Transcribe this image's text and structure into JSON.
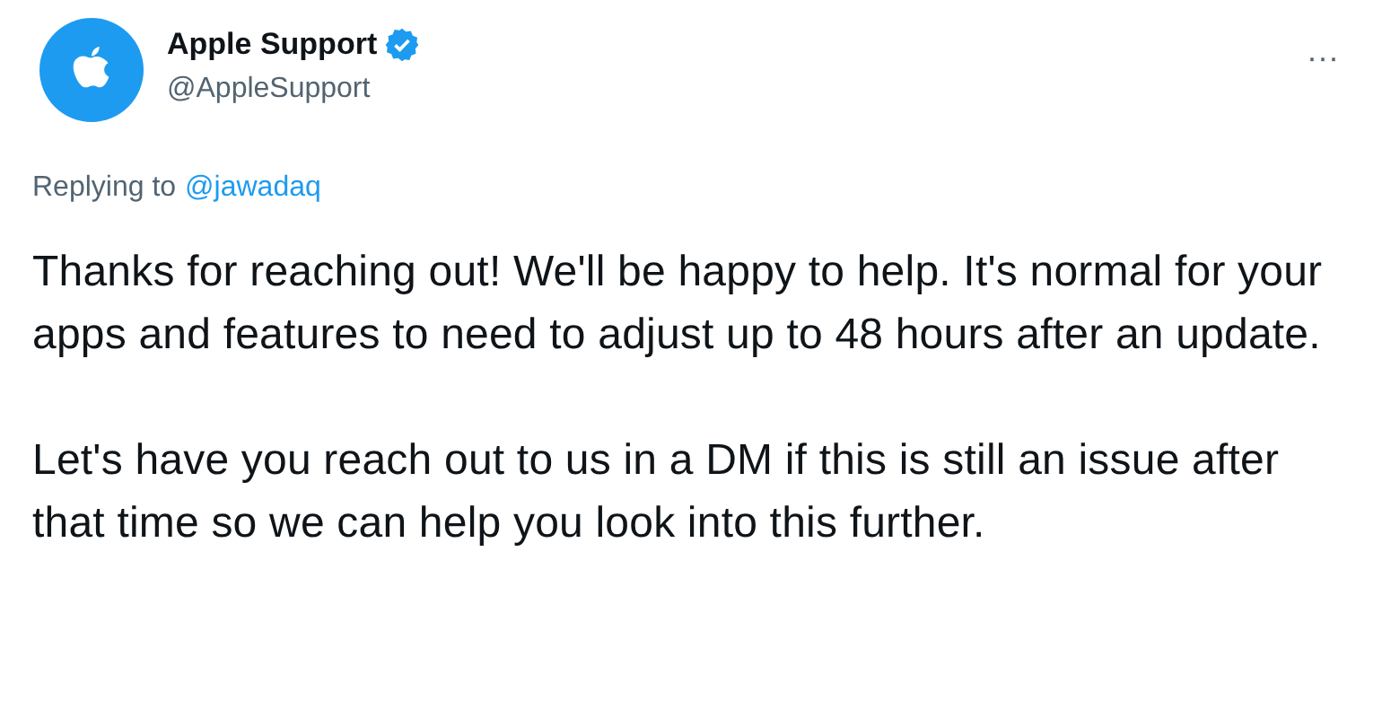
{
  "author": {
    "name": "Apple Support",
    "verified": true,
    "handle": "@AppleSupport"
  },
  "more": "···",
  "reply": {
    "prefix": "Replying to",
    "to": "@jawadaq"
  },
  "paragraphs": [
    "Thanks for reaching out! We'll be happy to help. It's normal for your apps and features to need to adjust up to 48 hours after an update.",
    "Let's have you reach out to us in a DM if this is still an issue after that time so we can help you look into this further."
  ]
}
